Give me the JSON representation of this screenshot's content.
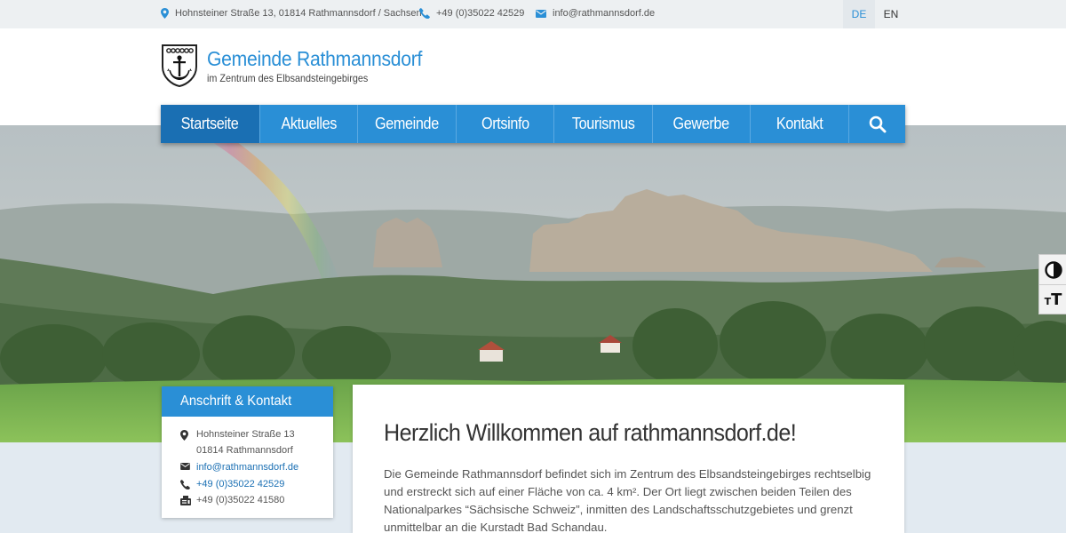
{
  "topbar": {
    "address": "Hohnsteiner Straße 13, 01814 Rathmannsdorf / Sachsen",
    "phone": "+49 (0)35022 42529",
    "email": "info@rathmannsdorf.de",
    "languages": [
      {
        "code": "DE",
        "active": true
      },
      {
        "code": "EN",
        "active": false
      }
    ]
  },
  "header": {
    "title": "Gemeinde Rathmannsdorf",
    "subtitle": "im Zentrum des Elbsandsteingebirges"
  },
  "nav": {
    "items": [
      {
        "label": "Startseite",
        "active": true
      },
      {
        "label": "Aktuelles",
        "active": false
      },
      {
        "label": "Gemeinde",
        "active": false
      },
      {
        "label": "Ortsinfo",
        "active": false
      },
      {
        "label": "Tourismus",
        "active": false
      },
      {
        "label": "Gewerbe",
        "active": false
      },
      {
        "label": "Kontakt",
        "active": false
      }
    ],
    "search_icon": "search-icon"
  },
  "accessibility": {
    "contrast_icon": "contrast-icon",
    "text_size_icon": "text-size-icon",
    "text_size_glyph": "T"
  },
  "contact_box": {
    "heading": "Anschrift & Kontakt",
    "street": "Hohnsteiner Straße 13",
    "city": "01814 Rathmannsdorf",
    "email": "info@rathmannsdorf.de",
    "phone": "+49 (0)35022 42529",
    "fax": "+49 (0)35022 41580"
  },
  "welcome": {
    "heading": "Herzlich Willkommen auf rathmannsdorf.de!",
    "text": "Die Gemeinde Rathmannsdorf befindet sich im Zentrum des Elbsandsteingebirges rechtselbig und erstreckt sich auf einer Fläche von ca. 4 km². Der Ort liegt zwischen beiden Teilen des Nationalparkes “Sächsische Schweiz”, inmitten des Landschaftsschutzgebietes und grenzt unmittelbar an die Kurstadt Bad Schandau."
  },
  "colors": {
    "brand": "#2a8fd6",
    "nav_active": "#1a6fb3",
    "topbar_bg": "#edf0f2",
    "link": "#1a6fb3"
  }
}
